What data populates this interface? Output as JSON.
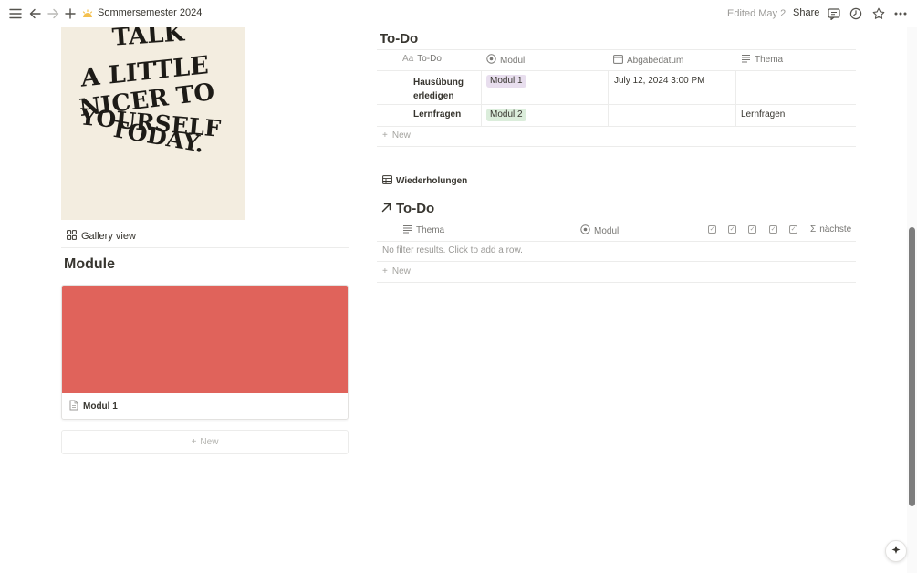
{
  "topbar": {
    "title": "Sommersemester 2024",
    "edited": "Edited May 2",
    "share": "Share",
    "icons": [
      "menu-icon",
      "back-arrow-icon",
      "forward-arrow-icon",
      "plus-icon",
      "sun-icon",
      "comment-icon",
      "clock-icon",
      "star-icon",
      "more-icon"
    ]
  },
  "poster": {
    "lines": [
      "TALK",
      "A LITTLE",
      "NICER TO",
      "YOURSELF",
      "TODAY."
    ]
  },
  "gallery": {
    "view_label": "Gallery view",
    "heading": "Module",
    "cards": [
      {
        "title": "Modul 1",
        "cover_color": "#e0635b"
      }
    ],
    "new_label": "New"
  },
  "todo_table": {
    "title": "To-Do",
    "columns": [
      {
        "icon": "Aa",
        "label": "To-Do"
      },
      {
        "icon": "status-icon",
        "label": "Modul"
      },
      {
        "icon": "calendar-icon",
        "label": "Abgabedatum"
      },
      {
        "icon": "text-icon",
        "label": "Thema"
      }
    ],
    "rows": [
      {
        "todo_line1": "Hausübung",
        "todo_line2": "erledigen",
        "modul": "Modul 1",
        "modul_color": "#e8deee",
        "abgabedatum": "July 12, 2024 3:00 PM",
        "thema": ""
      },
      {
        "todo_line1": "Lernfragen",
        "todo_line2": "",
        "modul": "Modul 2",
        "modul_color": "#dbeddb",
        "abgabedatum": "",
        "thema": "Lernfragen"
      }
    ],
    "new_label": "New"
  },
  "wiederholungen": {
    "tab_label": "Wiederholungen",
    "title": "To-Do",
    "columns": [
      {
        "icon": "text-icon",
        "label": "Thema"
      },
      {
        "icon": "status-icon",
        "label": "Modul"
      },
      {
        "icon": "sigma-icon",
        "label": "nächste"
      }
    ],
    "checkbox_columns": 5,
    "empty_message": "No filter results. Click to add a row.",
    "new_label": "New"
  },
  "colors": {
    "accent_card": "#e0635b",
    "tag_purple": "#e8deee",
    "tag_green": "#dbeddb"
  }
}
